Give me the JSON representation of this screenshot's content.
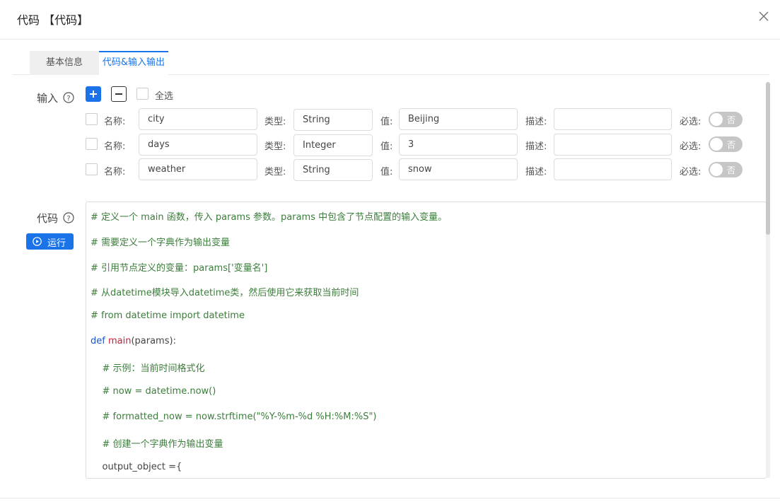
{
  "dialog": {
    "title": "代码 【代码】"
  },
  "tabs": [
    {
      "label": "基本信息",
      "active": false
    },
    {
      "label": "代码&输入输出",
      "active": true
    }
  ],
  "input_section": {
    "label": "输入",
    "select_all_label": "全选",
    "field_labels": {
      "name": "名称:",
      "type": "类型:",
      "value": "值:",
      "desc": "描述:",
      "required": "必选:"
    },
    "rows": [
      {
        "name": "city",
        "type": "String",
        "value": "Beijing",
        "desc": "",
        "required_label": "否"
      },
      {
        "name": "days",
        "type": "Integer",
        "value": "3",
        "desc": "",
        "required_label": "否"
      },
      {
        "name": "weather",
        "type": "String",
        "value": "snow",
        "desc": "",
        "required_label": "否"
      }
    ]
  },
  "code_section": {
    "label": "代码",
    "run_label": "运行",
    "lines": [
      "# 定义一个 main 函数，传入 params 参数。params 中包含了节点配置的输入变量。",
      "# 需要定义一个字典作为输出变量",
      "# 引用节点定义的变量：params['变量名']",
      "# 从datetime模块导入datetime类，然后使用它来获取当前时间",
      "# from datetime import datetime",
      "def main(params):",
      "    # 示例：当前时间格式化",
      "    # now = datetime.now()",
      "    # formatted_now = now.strftime(\"%Y-%m-%d %H:%M:%S\")",
      "    # 创建一个字典作为输出变量",
      "    output_object ={"
    ],
    "def_keyword": "def",
    "def_name": "main",
    "def_args": "(params):"
  },
  "colors": {
    "accent": "#1a73e8",
    "comment": "#3b7d3b",
    "keyword": "#1a55c8",
    "function": "#c3203c"
  },
  "icons": {
    "close": "close-icon",
    "help": "question-circle-icon",
    "run": "play-circle-icon"
  }
}
